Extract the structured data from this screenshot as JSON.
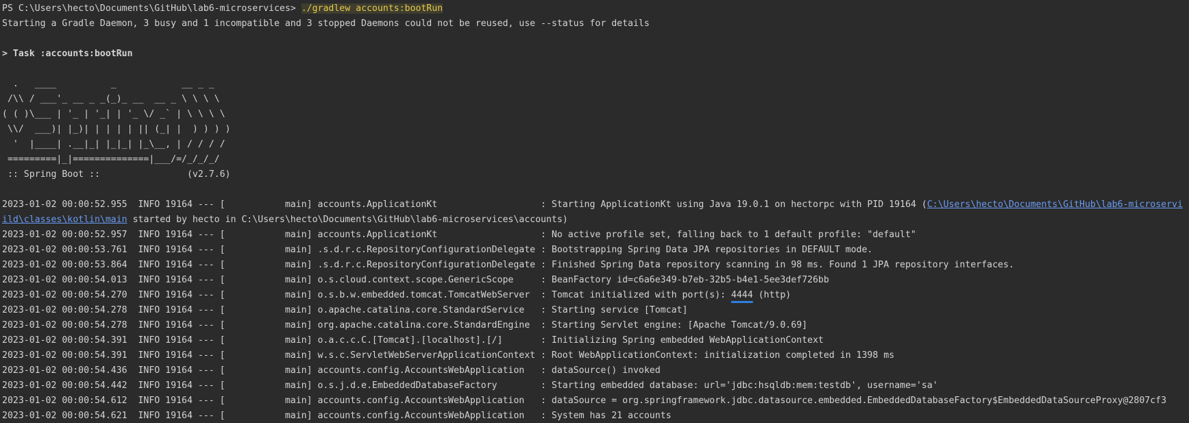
{
  "terminal": {
    "prompt": "PS C:\\Users\\hecto\\Documents\\GitHub\\lab6-microservices> ",
    "command": "./gradlew accounts:bootRun",
    "daemon_msg": "Starting a Gradle Daemon, 3 busy and 1 incompatible and 3 stopped Daemons could not be reused, use --status for details",
    "task": "> Task :accounts:bootRun",
    "banner": [
      "  .   ____          _            __ _ _",
      " /\\\\ / ___'_ __ _ _(_)_ __  __ _ \\ \\ \\ \\",
      "( ( )\\___ | '_ | '_| | '_ \\/ _` | \\ \\ \\ \\",
      " \\\\/  ___)| |_)| | | | | || (_| |  ) ) ) )",
      "  '  |____| .__|_| |_|_| |_\\__, | / / / /",
      " =========|_|==============|___/=/_/_/_/",
      " :: Spring Boot ::                (v2.7.6)"
    ],
    "log1_prefix": "2023-01-02 00:00:52.955  INFO 19164 --- [           main] accounts.ApplicationKt                   : Starting ApplicationKt using Java 19.0.1 on hectorpc with PID 19164 (",
    "log1_link": "C:\\Users\\hecto\\Documents\\GitHub\\lab6-microservi",
    "log1_cont_link": "ild\\classes\\kotlin\\main",
    "log1_cont_rest": " started by hecto in C:\\Users\\hecto\\Documents\\GitHub\\lab6-microservices\\accounts)",
    "log2": "2023-01-02 00:00:52.957  INFO 19164 --- [           main] accounts.ApplicationKt                   : No active profile set, falling back to 1 default profile: \"default\"",
    "log3": "2023-01-02 00:00:53.761  INFO 19164 --- [           main] .s.d.r.c.RepositoryConfigurationDelegate : Bootstrapping Spring Data JPA repositories in DEFAULT mode.",
    "log4": "2023-01-02 00:00:53.864  INFO 19164 --- [           main] .s.d.r.c.RepositoryConfigurationDelegate : Finished Spring Data repository scanning in 98 ms. Found 1 JPA repository interfaces.",
    "log5": "2023-01-02 00:00:54.013  INFO 19164 --- [           main] o.s.cloud.context.scope.GenericScope     : BeanFactory id=c6a6e349-b7eb-32b5-b4e1-5ee3def726bb",
    "log6_prefix": "2023-01-02 00:00:54.270  INFO 19164 --- [           main] o.s.b.w.embedded.tomcat.TomcatWebServer  : Tomcat initialized with port(s): ",
    "log6_port": "4444",
    "log6_suffix": " (http)",
    "log7": "2023-01-02 00:00:54.278  INFO 19164 --- [           main] o.apache.catalina.core.StandardService   : Starting service [Tomcat]",
    "log8": "2023-01-02 00:00:54.278  INFO 19164 --- [           main] org.apache.catalina.core.StandardEngine  : Starting Servlet engine: [Apache Tomcat/9.0.69]",
    "log9": "2023-01-02 00:00:54.391  INFO 19164 --- [           main] o.a.c.c.C.[Tomcat].[localhost].[/]       : Initializing Spring embedded WebApplicationContext",
    "log10": "2023-01-02 00:00:54.391  INFO 19164 --- [           main] w.s.c.ServletWebServerApplicationContext : Root WebApplicationContext: initialization completed in 1398 ms",
    "log11": "2023-01-02 00:00:54.436  INFO 19164 --- [           main] accounts.config.AccountsWebApplication   : dataSource() invoked",
    "log12": "2023-01-02 00:00:54.442  INFO 19164 --- [           main] o.s.j.d.e.EmbeddedDatabaseFactory        : Starting embedded database: url='jdbc:hsqldb:mem:testdb', username='sa'",
    "log13": "2023-01-02 00:00:54.612  INFO 19164 --- [           main] accounts.config.AccountsWebApplication   : dataSource = org.springframework.jdbc.datasource.embedded.EmbeddedDatabaseFactory$EmbeddedDataSourceProxy@2807cf3",
    "log14": "2023-01-02 00:00:54.621  INFO 19164 --- [           main] accounts.config.AccountsWebApplication   : System has 21 accounts"
  },
  "colors": {
    "background": "#2b2b2b",
    "text": "#d4d4d4",
    "command": "#e6c94a",
    "link": "#6a9bf4",
    "port_underline": "#2f7fe0"
  }
}
